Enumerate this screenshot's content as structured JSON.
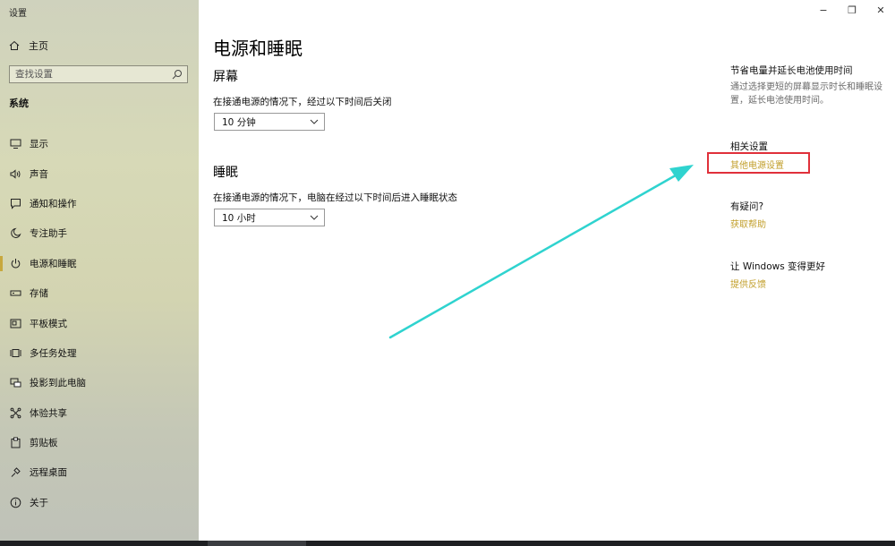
{
  "window": {
    "title": "设置",
    "controls": {
      "minimize": "−",
      "maximize": "❐",
      "close": "✕"
    }
  },
  "sidebar": {
    "home_label": "主页",
    "search_placeholder": "查找设置",
    "section_label": "系统",
    "active_index": 4,
    "items": [
      {
        "label": "显示",
        "icon": "monitor-icon"
      },
      {
        "label": "声音",
        "icon": "speaker-icon"
      },
      {
        "label": "通知和操作",
        "icon": "notification-icon"
      },
      {
        "label": "专注助手",
        "icon": "moon-icon"
      },
      {
        "label": "电源和睡眠",
        "icon": "power-icon"
      },
      {
        "label": "存储",
        "icon": "storage-icon"
      },
      {
        "label": "平板模式",
        "icon": "tablet-icon"
      },
      {
        "label": "多任务处理",
        "icon": "multitask-icon"
      },
      {
        "label": "投影到此电脑",
        "icon": "project-icon"
      },
      {
        "label": "体验共享",
        "icon": "share-icon"
      },
      {
        "label": "剪贴板",
        "icon": "clipboard-icon"
      },
      {
        "label": "远程桌面",
        "icon": "remote-icon"
      },
      {
        "label": "关于",
        "icon": "info-icon"
      }
    ]
  },
  "main": {
    "title": "电源和睡眠",
    "screen": {
      "heading": "屏幕",
      "description": "在接通电源的情况下，经过以下时间后关闭",
      "value": "10 分钟"
    },
    "sleep": {
      "heading": "睡眠",
      "description": "在接通电源的情况下，电脑在经过以下时间后进入睡眠状态",
      "value": "10 小时"
    }
  },
  "right": {
    "battery": {
      "heading": "节省电量并延长电池使用时间",
      "text": "通过选择更短的屏幕显示时长和睡眠设置，延长电池使用时间。"
    },
    "related": {
      "heading": "相关设置",
      "link": "其他电源设置"
    },
    "question": {
      "heading": "有疑问?",
      "link": "获取帮助"
    },
    "improve": {
      "heading": "让 Windows 变得更好",
      "link": "提供反馈"
    }
  },
  "colors": {
    "accent_link": "#c29f2b",
    "highlight_box": "#e0303a",
    "arrow": "#2fd3cf",
    "active_indicator": "#c7a83e"
  }
}
